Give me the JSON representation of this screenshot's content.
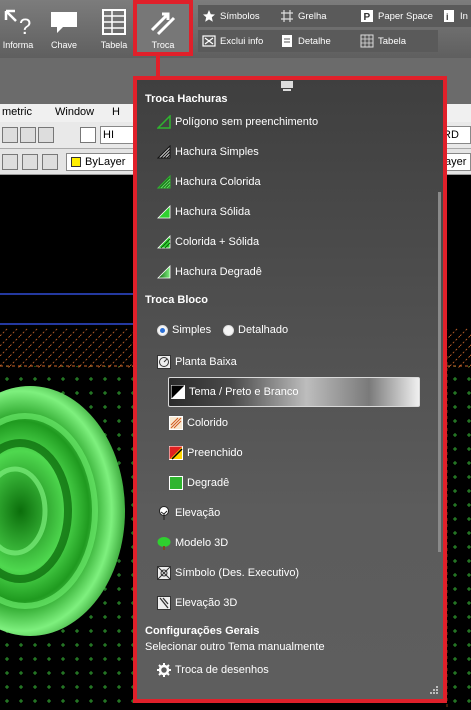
{
  "ribbon": {
    "buttons": [
      {
        "label": "Informa",
        "icon": "info-icon"
      },
      {
        "label": "Chave",
        "icon": "speech-bubble-icon"
      },
      {
        "label": "Tabela",
        "icon": "table-icon"
      },
      {
        "label": "Troca",
        "icon": "swap-arrows-icon"
      }
    ],
    "row1": [
      "Símbolos",
      "Grelha",
      "Paper Space",
      "In"
    ],
    "row2": [
      "Exclui info",
      "Detalhe",
      "Tabela"
    ]
  },
  "cad": {
    "menu": [
      "metric",
      "Window",
      "H"
    ],
    "toolbar_text": "HI",
    "toolbar_right": "RD",
    "layer_label": "ByLayer",
    "layer_right": "ayer"
  },
  "popup": {
    "sections": {
      "hatch": "Troca Hachuras",
      "block": "Troca Bloco",
      "general": "Configurações Gerais"
    },
    "hatch_items": [
      "Polígono sem preenchimento",
      "Hachura Simples",
      "Hachura Colorida",
      "Hachura Sólida",
      "Colorida + Sólida",
      "Hachura Degradê"
    ],
    "radios": {
      "simple": "Simples",
      "detailed": "Detalhado",
      "selected": "Simples"
    },
    "block_items": {
      "planta": "Planta Baixa",
      "tema": "Tema / Preto e Branco",
      "colorido": "Colorido",
      "preenchido": "Preenchido",
      "degrade": "Degradê",
      "elevacao": "Elevação",
      "modelo": "Modelo 3D",
      "simbolo": "Símbolo (Des. Executivo)",
      "elevacao3d": "Elevação 3D"
    },
    "general_text": "Selecionar outro Tema manualmente",
    "general_item": "Troca de desenhos"
  },
  "colors": {
    "highlight_border": "#e0202a",
    "accent_green": "#2fb52f"
  }
}
